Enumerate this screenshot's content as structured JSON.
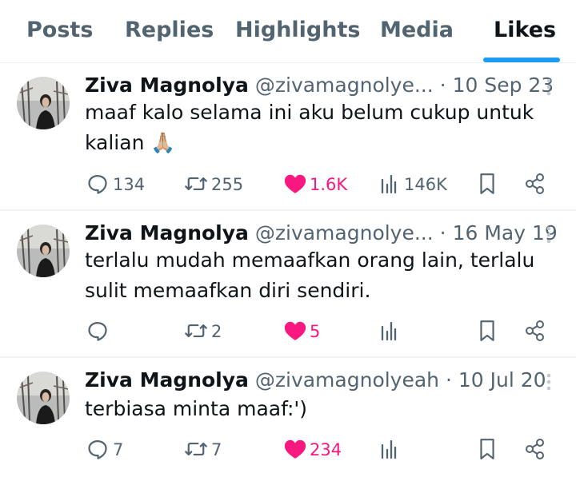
{
  "tabs": [
    {
      "label": "Posts"
    },
    {
      "label": "Replies"
    },
    {
      "label": "Highlights"
    },
    {
      "label": "Media"
    },
    {
      "label": "Likes"
    }
  ],
  "active_tab": "Likes",
  "colors": {
    "accent": "#1d9bf0",
    "like": "#f91880",
    "secondary_text": "#536471",
    "primary_text": "#0f1419"
  },
  "tweets": [
    {
      "name": "Ziva Magnolya",
      "handle": "@zivamagnolye...",
      "separator": "·",
      "date": "10 Sep 23",
      "text_lines": [
        "maaf kalo selama ini aku belum cukup untuk",
        "kalian 🙏🏼"
      ],
      "replies": "134",
      "reposts": "255",
      "likes": "1.6K",
      "views": "146K",
      "liked": true
    },
    {
      "name": "Ziva Magnolya",
      "handle": "@zivamagnolye...",
      "separator": "·",
      "date": "16 May 19",
      "text_lines": [
        "terlalu mudah memaafkan orang lain, terlalu",
        "sulit memaafkan diri sendiri."
      ],
      "replies": "",
      "reposts": "2",
      "likes": "5",
      "views": "",
      "liked": true
    },
    {
      "name": "Ziva Magnolya",
      "handle": "@zivamagnolyeah",
      "separator": "·",
      "date": "10 Jul 20",
      "text_lines": [
        "terbiasa minta maaf:')"
      ],
      "replies": "7",
      "reposts": "7",
      "likes": "234",
      "views": "",
      "liked": true
    }
  ],
  "icons": {
    "reply": "reply-icon",
    "repost": "repost-icon",
    "like": "heart-icon",
    "views": "views-icon",
    "bookmark": "bookmark-icon",
    "share": "share-icon",
    "more": "more-vertical-icon"
  }
}
